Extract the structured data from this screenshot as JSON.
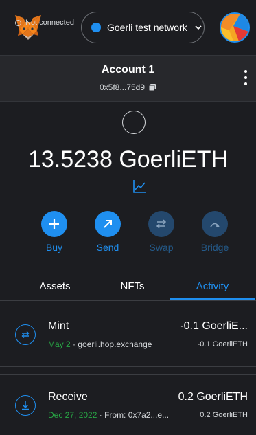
{
  "header": {
    "network_label": "Goerli test network",
    "network_dot_color": "#1f8ff0"
  },
  "account": {
    "status": "Not connected",
    "name": "Account 1",
    "address": "0x5f8...75d9"
  },
  "balance": {
    "amount": "13.5238 GoerliETH"
  },
  "actions": [
    {
      "label": "Buy",
      "icon": "plus-icon",
      "enabled": true
    },
    {
      "label": "Send",
      "icon": "arrow-up-right-icon",
      "enabled": true
    },
    {
      "label": "Swap",
      "icon": "swap-icon",
      "enabled": false
    },
    {
      "label": "Bridge",
      "icon": "bridge-icon",
      "enabled": false
    }
  ],
  "tabs": [
    {
      "label": "Assets",
      "active": false
    },
    {
      "label": "NFTs",
      "active": false
    },
    {
      "label": "Activity",
      "active": true
    }
  ],
  "transactions": [
    {
      "title": "Mint",
      "date": "May 2",
      "separator": " · ",
      "detail": "goerli.hop.exchange",
      "amount": "-0.1 GoerliE...",
      "amount_secondary": "-0.1 GoerliETH",
      "icon": "swap-arrows-icon"
    },
    {
      "title": "Receive",
      "date": "Dec 27, 2022",
      "separator": " · ",
      "detail": "From: 0x7a2...e...",
      "amount": "0.2 GoerliETH",
      "amount_secondary": "0.2 GoerliETH",
      "icon": "receive-icon"
    }
  ],
  "colors": {
    "accent": "#1f8ff0",
    "background": "#1c1d21",
    "success": "#28a745"
  }
}
